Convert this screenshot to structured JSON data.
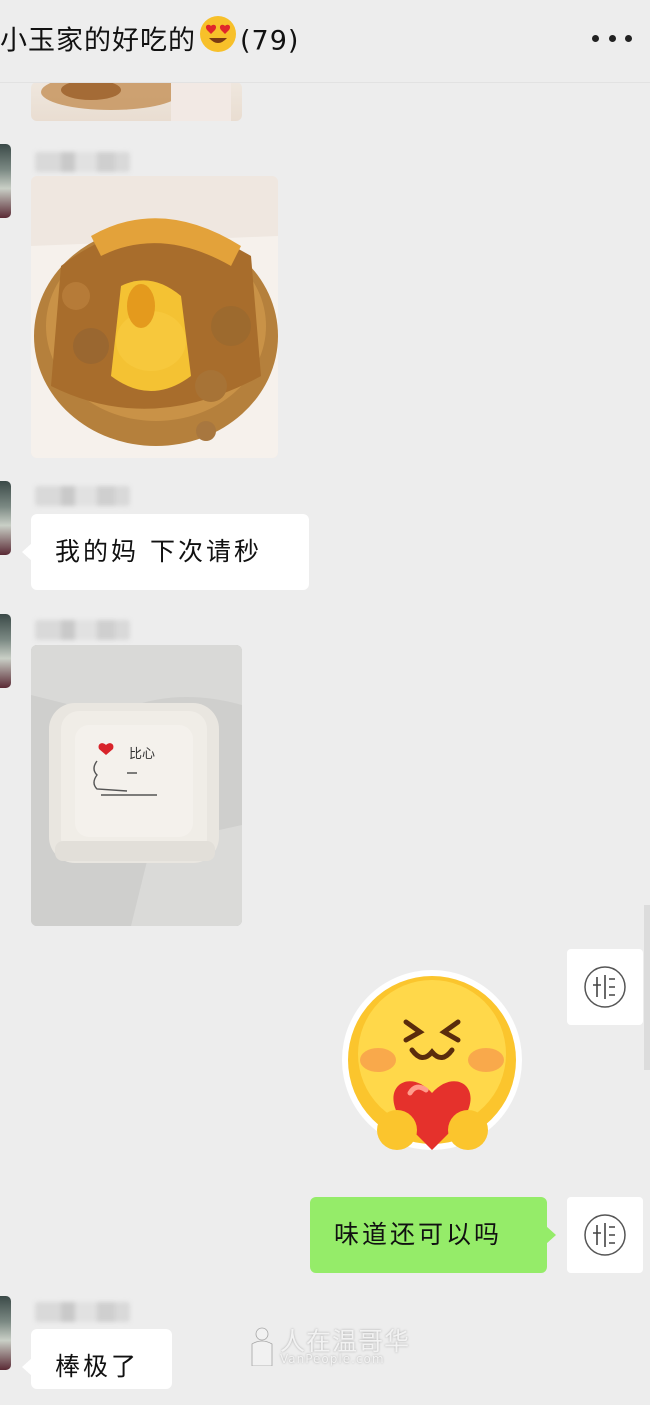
{
  "header": {
    "title": "小玉家的好吃的",
    "title_emoji": "heart-eyes-emoji",
    "member_count": "(79)",
    "more_icon": "more-dots-icon"
  },
  "messages": [
    {
      "type": "image",
      "sender": "other",
      "description_icon": "food-photo"
    },
    {
      "type": "image",
      "sender": "other",
      "description_icon": "pork-floss-cake-photo"
    },
    {
      "type": "text",
      "sender": "other",
      "text": "我的妈 下次请秒"
    },
    {
      "type": "image",
      "sender": "other",
      "description_icon": "takeout-box-photo"
    },
    {
      "type": "sticker",
      "sender": "self",
      "description_icon": "blushing-heart-emoji-sticker"
    },
    {
      "type": "text",
      "sender": "self",
      "text": "味道还可以吗"
    },
    {
      "type": "text",
      "sender": "other",
      "text": "棒极了"
    }
  ],
  "box_doodle_text": "比心",
  "self_avatar_icon": "stamp-logo-icon",
  "watermark": {
    "main": "人在温哥华",
    "sub": "VanPeople.com"
  },
  "colors": {
    "background": "#ededed",
    "incoming_bubble": "#ffffff",
    "outgoing_bubble": "#95ec69"
  }
}
